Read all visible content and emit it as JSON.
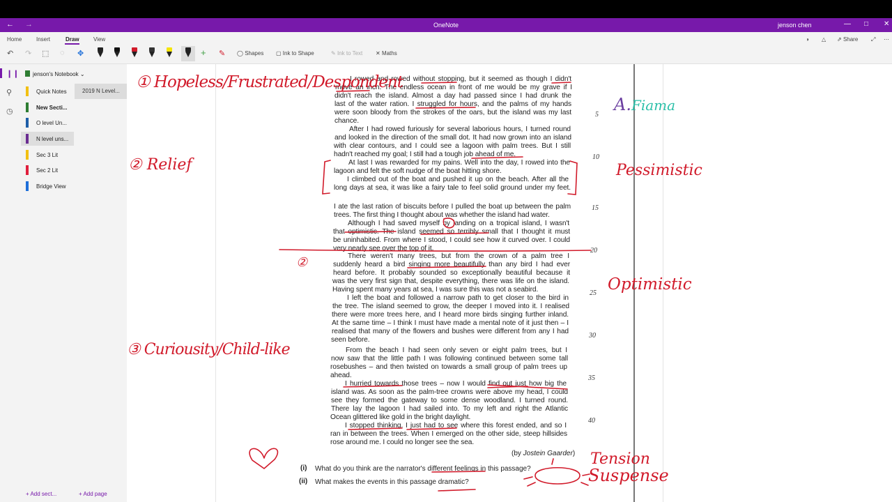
{
  "app": {
    "title": "OneNote",
    "user": "jenson chen",
    "colors": {
      "brand": "#7719aa",
      "ink_red": "#d11a2a",
      "ink_green": "#43a047"
    }
  },
  "ribbon": {
    "tabs": [
      "Home",
      "Insert",
      "Draw",
      "View"
    ],
    "active_tab": "Draw",
    "tools": {
      "shapes": "Shapes",
      "ink_to_shape": "Ink to Shape",
      "ink_to_text": "Ink to Text",
      "maths": "Maths"
    },
    "share": "Share"
  },
  "notebook": {
    "name": "jenson's Notebook",
    "sections": [
      {
        "label": "Quick Notes",
        "color": "#f2c012"
      },
      {
        "label": "New Secti...",
        "color": "#2e7d32"
      },
      {
        "label": "O level Un...",
        "color": "#1e5ea8"
      },
      {
        "label": "N level uns...",
        "color": "#6a2c91"
      },
      {
        "label": "Sec 3 Lit",
        "color": "#f2c012"
      },
      {
        "label": "Sec 2 Lit",
        "color": "#e01e3c"
      },
      {
        "label": "Bridge View",
        "color": "#1e6fd9"
      }
    ],
    "selected_section": "N level uns...",
    "pages": [
      "2019 N Level..."
    ],
    "add_section": "Add sect...",
    "add_page": "Add page"
  },
  "passage": {
    "lines": [
      "I rowed and rowed without stopping, but it seemed as though I didn't",
      "move an inch. The endless ocean in front of me would be my grave if I",
      "didn't reach the island. Almost a day had passed since I had drunk the",
      "last of the water ration. I struggled for hours, and the palms of my hands",
      "were soon bloody from the strokes of the oars, but the island was my last",
      "chance.",
      "After I had rowed furiously for several laborious hours, I turned round",
      "and looked in the direction of the small dot. It had now grown into an island",
      "with clear contours, and I could see a lagoon with palm trees. But I still",
      "hadn't reached my goal; I still had a tough job ahead of me.",
      "At last I was rewarded for my pains. Well into the day, I rowed into the",
      "lagoon and felt the soft nudge of the boat hitting shore.",
      "I climbed out of the boat and pushed it up on the beach. After all the",
      "long days at sea, it was like a fairy tale to feel solid ground under my feet.",
      "I ate the last ration of biscuits before I pulled the boat up between the palm",
      "trees. The first thing I thought about was whether the island had water.",
      "Although I had saved myself by landing on a tropical island, I wasn't",
      "that optimistic. The island seemed so terribly small that I thought it must",
      "be uninhabited. From where I stood, I could see how it curved over. I could",
      "very nearly see over the top of it.",
      "There weren't many trees, but from the crown of a palm tree I",
      "suddenly heard a bird singing more beautifully than any bird I had ever",
      "heard before. It probably sounded so exceptionally beautiful because it",
      "was the very first sign that, despite everything, there was life on the island.",
      "Having spent many years at sea, I was sure this was not a seabird.",
      "I left the boat and followed a narrow path to get closer to the bird in",
      "the tree. The island seemed to grow, the deeper I moved into it. I realised",
      "there were more trees here, and I heard more birds singing further inland.",
      "At the same time – I think I must have made a mental note of it just then – I",
      "realised that many of the flowers and bushes were different from any I had",
      "seen before.",
      "From the beach I had seen only seven or eight palm trees, but I",
      "now saw that the little path I was following continued between some tall",
      "rosebushes – and then twisted on towards a small group of palm trees up",
      "ahead.",
      "I hurried towards those trees – now I would find out just how big the",
      "island was. As soon as the palm-tree crowns were above my head, I could",
      "see they formed the gateway to some dense woodland. I turned round.",
      "There lay the lagoon I had sailed into. To my left and right the Atlantic",
      "Ocean glittered like gold in the bright daylight.",
      "I stopped thinking. I just had to see where this forest ended, and so I",
      "ran in between the trees. When I emerged on the other side, steep hillsides",
      "rose around me. I could no longer see the sea."
    ],
    "line_numbers": [
      "5",
      "10",
      "15",
      "20",
      "25",
      "30",
      "35",
      "40"
    ],
    "byline_prefix": "(by ",
    "byline_author": "Jostein Gaarder",
    "byline_suffix": ")",
    "questions": [
      {
        "num": "(i)",
        "text": "What do you think are the narrator's different feelings in this passage?"
      },
      {
        "num": "(ii)",
        "text": "What makes the events in this passage dramatic?"
      }
    ]
  },
  "annotations": {
    "feeling1": "① Hopeless/Frustrated/Despondent",
    "feeling2": "② Relief",
    "feeling3": "③ Curiousity/Child-like",
    "right1_prefix": "A.",
    "right1_word": "Fiama",
    "right2": "Pessimistic",
    "right3": "Optimistic",
    "right4": "Tension",
    "right5": "Suspense",
    "circle2": "②"
  }
}
